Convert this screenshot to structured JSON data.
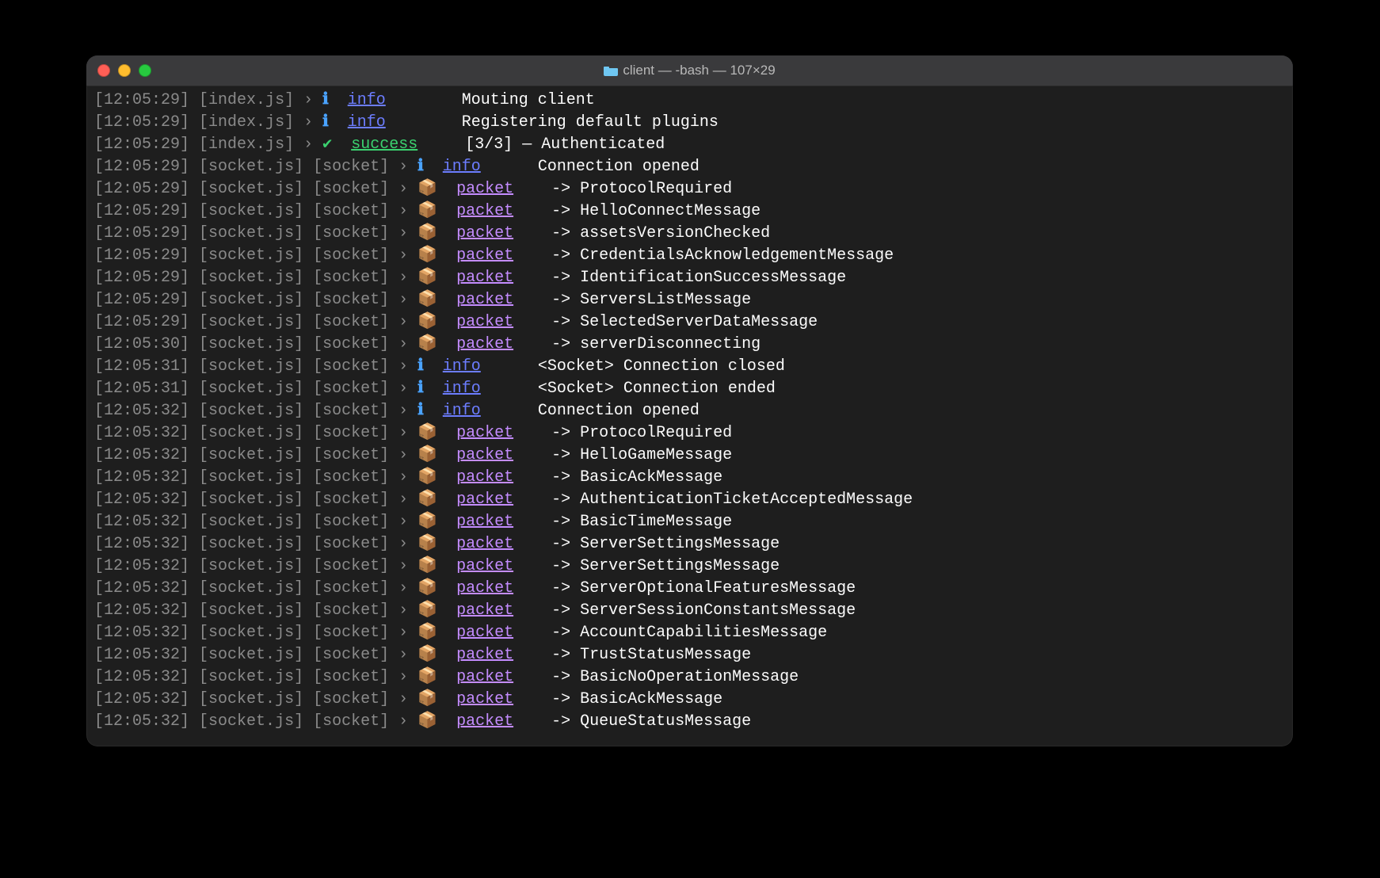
{
  "window": {
    "title_prefix": "client — -bash — ",
    "title_dims": "107×29"
  },
  "labels": {
    "info": "info",
    "success": "success",
    "packet": "packet",
    "chevron": "›",
    "info_icon": "ℹ",
    "check_icon": "✔",
    "package_icon": "📦"
  },
  "lines": [
    {
      "ts": "12:05:29",
      "src": "index.js",
      "ctx": null,
      "type": "info",
      "msg": "Mouting client"
    },
    {
      "ts": "12:05:29",
      "src": "index.js",
      "ctx": null,
      "type": "info",
      "msg": "Registering default plugins"
    },
    {
      "ts": "12:05:29",
      "src": "index.js",
      "ctx": null,
      "type": "success",
      "msg": "[3/3] — Authenticated"
    },
    {
      "ts": "12:05:29",
      "src": "socket.js",
      "ctx": "socket",
      "type": "info",
      "msg": "Connection opened"
    },
    {
      "ts": "12:05:29",
      "src": "socket.js",
      "ctx": "socket",
      "type": "packet",
      "msg": "-> ProtocolRequired"
    },
    {
      "ts": "12:05:29",
      "src": "socket.js",
      "ctx": "socket",
      "type": "packet",
      "msg": "-> HelloConnectMessage"
    },
    {
      "ts": "12:05:29",
      "src": "socket.js",
      "ctx": "socket",
      "type": "packet",
      "msg": "-> assetsVersionChecked"
    },
    {
      "ts": "12:05:29",
      "src": "socket.js",
      "ctx": "socket",
      "type": "packet",
      "msg": "-> CredentialsAcknowledgementMessage"
    },
    {
      "ts": "12:05:29",
      "src": "socket.js",
      "ctx": "socket",
      "type": "packet",
      "msg": "-> IdentificationSuccessMessage"
    },
    {
      "ts": "12:05:29",
      "src": "socket.js",
      "ctx": "socket",
      "type": "packet",
      "msg": "-> ServersListMessage"
    },
    {
      "ts": "12:05:29",
      "src": "socket.js",
      "ctx": "socket",
      "type": "packet",
      "msg": "-> SelectedServerDataMessage"
    },
    {
      "ts": "12:05:30",
      "src": "socket.js",
      "ctx": "socket",
      "type": "packet",
      "msg": "-> serverDisconnecting"
    },
    {
      "ts": "12:05:31",
      "src": "socket.js",
      "ctx": "socket",
      "type": "info",
      "msg": "<Socket> Connection closed"
    },
    {
      "ts": "12:05:31",
      "src": "socket.js",
      "ctx": "socket",
      "type": "info",
      "msg": "<Socket> Connection ended"
    },
    {
      "ts": "12:05:32",
      "src": "socket.js",
      "ctx": "socket",
      "type": "info",
      "msg": "Connection opened"
    },
    {
      "ts": "12:05:32",
      "src": "socket.js",
      "ctx": "socket",
      "type": "packet",
      "msg": "-> ProtocolRequired"
    },
    {
      "ts": "12:05:32",
      "src": "socket.js",
      "ctx": "socket",
      "type": "packet",
      "msg": "-> HelloGameMessage"
    },
    {
      "ts": "12:05:32",
      "src": "socket.js",
      "ctx": "socket",
      "type": "packet",
      "msg": "-> BasicAckMessage"
    },
    {
      "ts": "12:05:32",
      "src": "socket.js",
      "ctx": "socket",
      "type": "packet",
      "msg": "-> AuthenticationTicketAcceptedMessage"
    },
    {
      "ts": "12:05:32",
      "src": "socket.js",
      "ctx": "socket",
      "type": "packet",
      "msg": "-> BasicTimeMessage"
    },
    {
      "ts": "12:05:32",
      "src": "socket.js",
      "ctx": "socket",
      "type": "packet",
      "msg": "-> ServerSettingsMessage"
    },
    {
      "ts": "12:05:32",
      "src": "socket.js",
      "ctx": "socket",
      "type": "packet",
      "msg": "-> ServerSettingsMessage"
    },
    {
      "ts": "12:05:32",
      "src": "socket.js",
      "ctx": "socket",
      "type": "packet",
      "msg": "-> ServerOptionalFeaturesMessage"
    },
    {
      "ts": "12:05:32",
      "src": "socket.js",
      "ctx": "socket",
      "type": "packet",
      "msg": "-> ServerSessionConstantsMessage"
    },
    {
      "ts": "12:05:32",
      "src": "socket.js",
      "ctx": "socket",
      "type": "packet",
      "msg": "-> AccountCapabilitiesMessage"
    },
    {
      "ts": "12:05:32",
      "src": "socket.js",
      "ctx": "socket",
      "type": "packet",
      "msg": "-> TrustStatusMessage"
    },
    {
      "ts": "12:05:32",
      "src": "socket.js",
      "ctx": "socket",
      "type": "packet",
      "msg": "-> BasicNoOperationMessage"
    },
    {
      "ts": "12:05:32",
      "src": "socket.js",
      "ctx": "socket",
      "type": "packet",
      "msg": "-> BasicAckMessage"
    },
    {
      "ts": "12:05:32",
      "src": "socket.js",
      "ctx": "socket",
      "type": "packet",
      "msg": "-> QueueStatusMessage"
    }
  ]
}
